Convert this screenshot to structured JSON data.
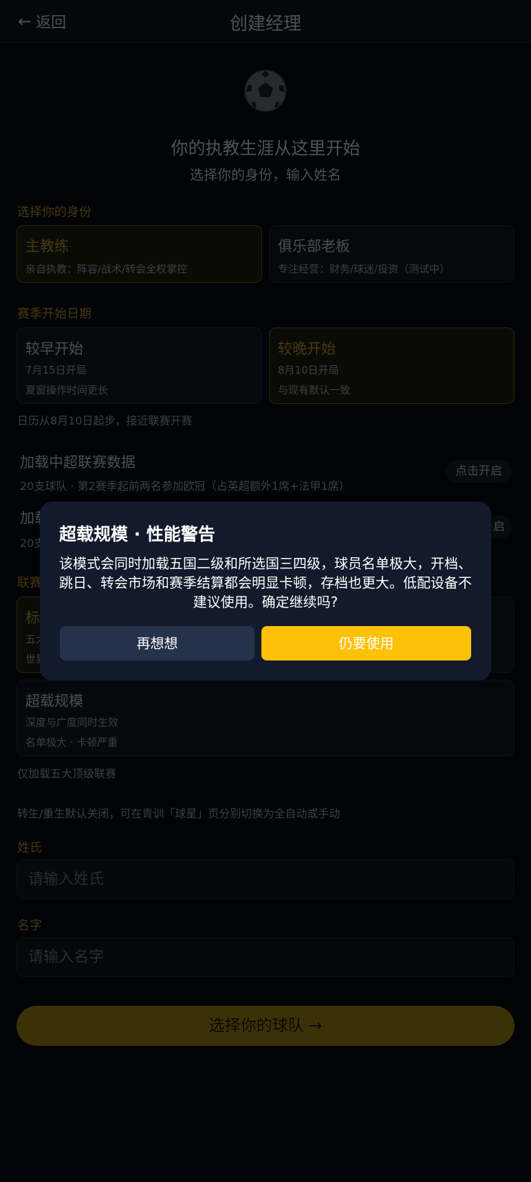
{
  "header": {
    "back_label": "返回",
    "back_icon": "arrow-left-icon",
    "title": "创建经理"
  },
  "hero": {
    "icon": "soccer-ball-icon",
    "title": "你的执教生涯从这里开始",
    "subtitle": "选择你的身份，输入姓名"
  },
  "identity": {
    "label": "选择你的身份",
    "options": [
      {
        "title": "主教练",
        "desc": "亲自执教：阵容/战术/转会全权掌控",
        "selected": true
      },
      {
        "title": "俱乐部老板",
        "desc": "专注经营：财务/球迷/投资（测试中）",
        "selected": false
      }
    ]
  },
  "season": {
    "label": "赛季开始日期",
    "options": [
      {
        "title": "较早开始",
        "line1": "7月15日开局",
        "line2": "夏窗操作时间更长",
        "selected": false
      },
      {
        "title": "较晚开始",
        "line1": "8月10日开局",
        "line2": "与现有默认一致",
        "selected": true
      }
    ],
    "hint": "日历从8月10日起步，接近联赛开赛"
  },
  "load_csl": {
    "title": "加载中超联赛数据",
    "desc": "20支球队 · 第2赛季起前两名参加欧冠（占英超额外1席+法甲1席）",
    "button": "点击开启"
  },
  "load_second": {
    "title_partial": "加载",
    "desc_partial": "20支",
    "button_partial": "启"
  },
  "league_scale": {
    "label_partial": "联赛",
    "standard_partial": {
      "title": "标",
      "line1": "五大",
      "line2": "世界"
    },
    "overload": {
      "title": "超载规模",
      "line1": "深度与广度同时生效",
      "line2": "名单极大 · 卡顿严重"
    },
    "hint": "仅加载五大顶级联赛"
  },
  "regen_hint": "转生/重生默认关闭，可在青训「球星」页分别切换为全自动或手动",
  "surname": {
    "label": "姓氏",
    "placeholder": "请输入姓氏"
  },
  "given_name": {
    "label": "名字",
    "placeholder": "请输入名字"
  },
  "cta": {
    "label": "选择你的球队 →"
  },
  "modal": {
    "title": "超载规模 · 性能警告",
    "body": "该模式会同时加载五国二级和所选国三四级，球员名单极大，开档、跳日、转会市场和赛季结算都会明显卡顿，存档也更大。低配设备不建议使用。确定继续吗?",
    "cancel": "再想想",
    "confirm": "仍要使用"
  },
  "colors": {
    "accent": "#ffc107",
    "modal_bg": "#121a2b",
    "cancel_bg": "#26314a",
    "page_bg": "#05070b"
  }
}
